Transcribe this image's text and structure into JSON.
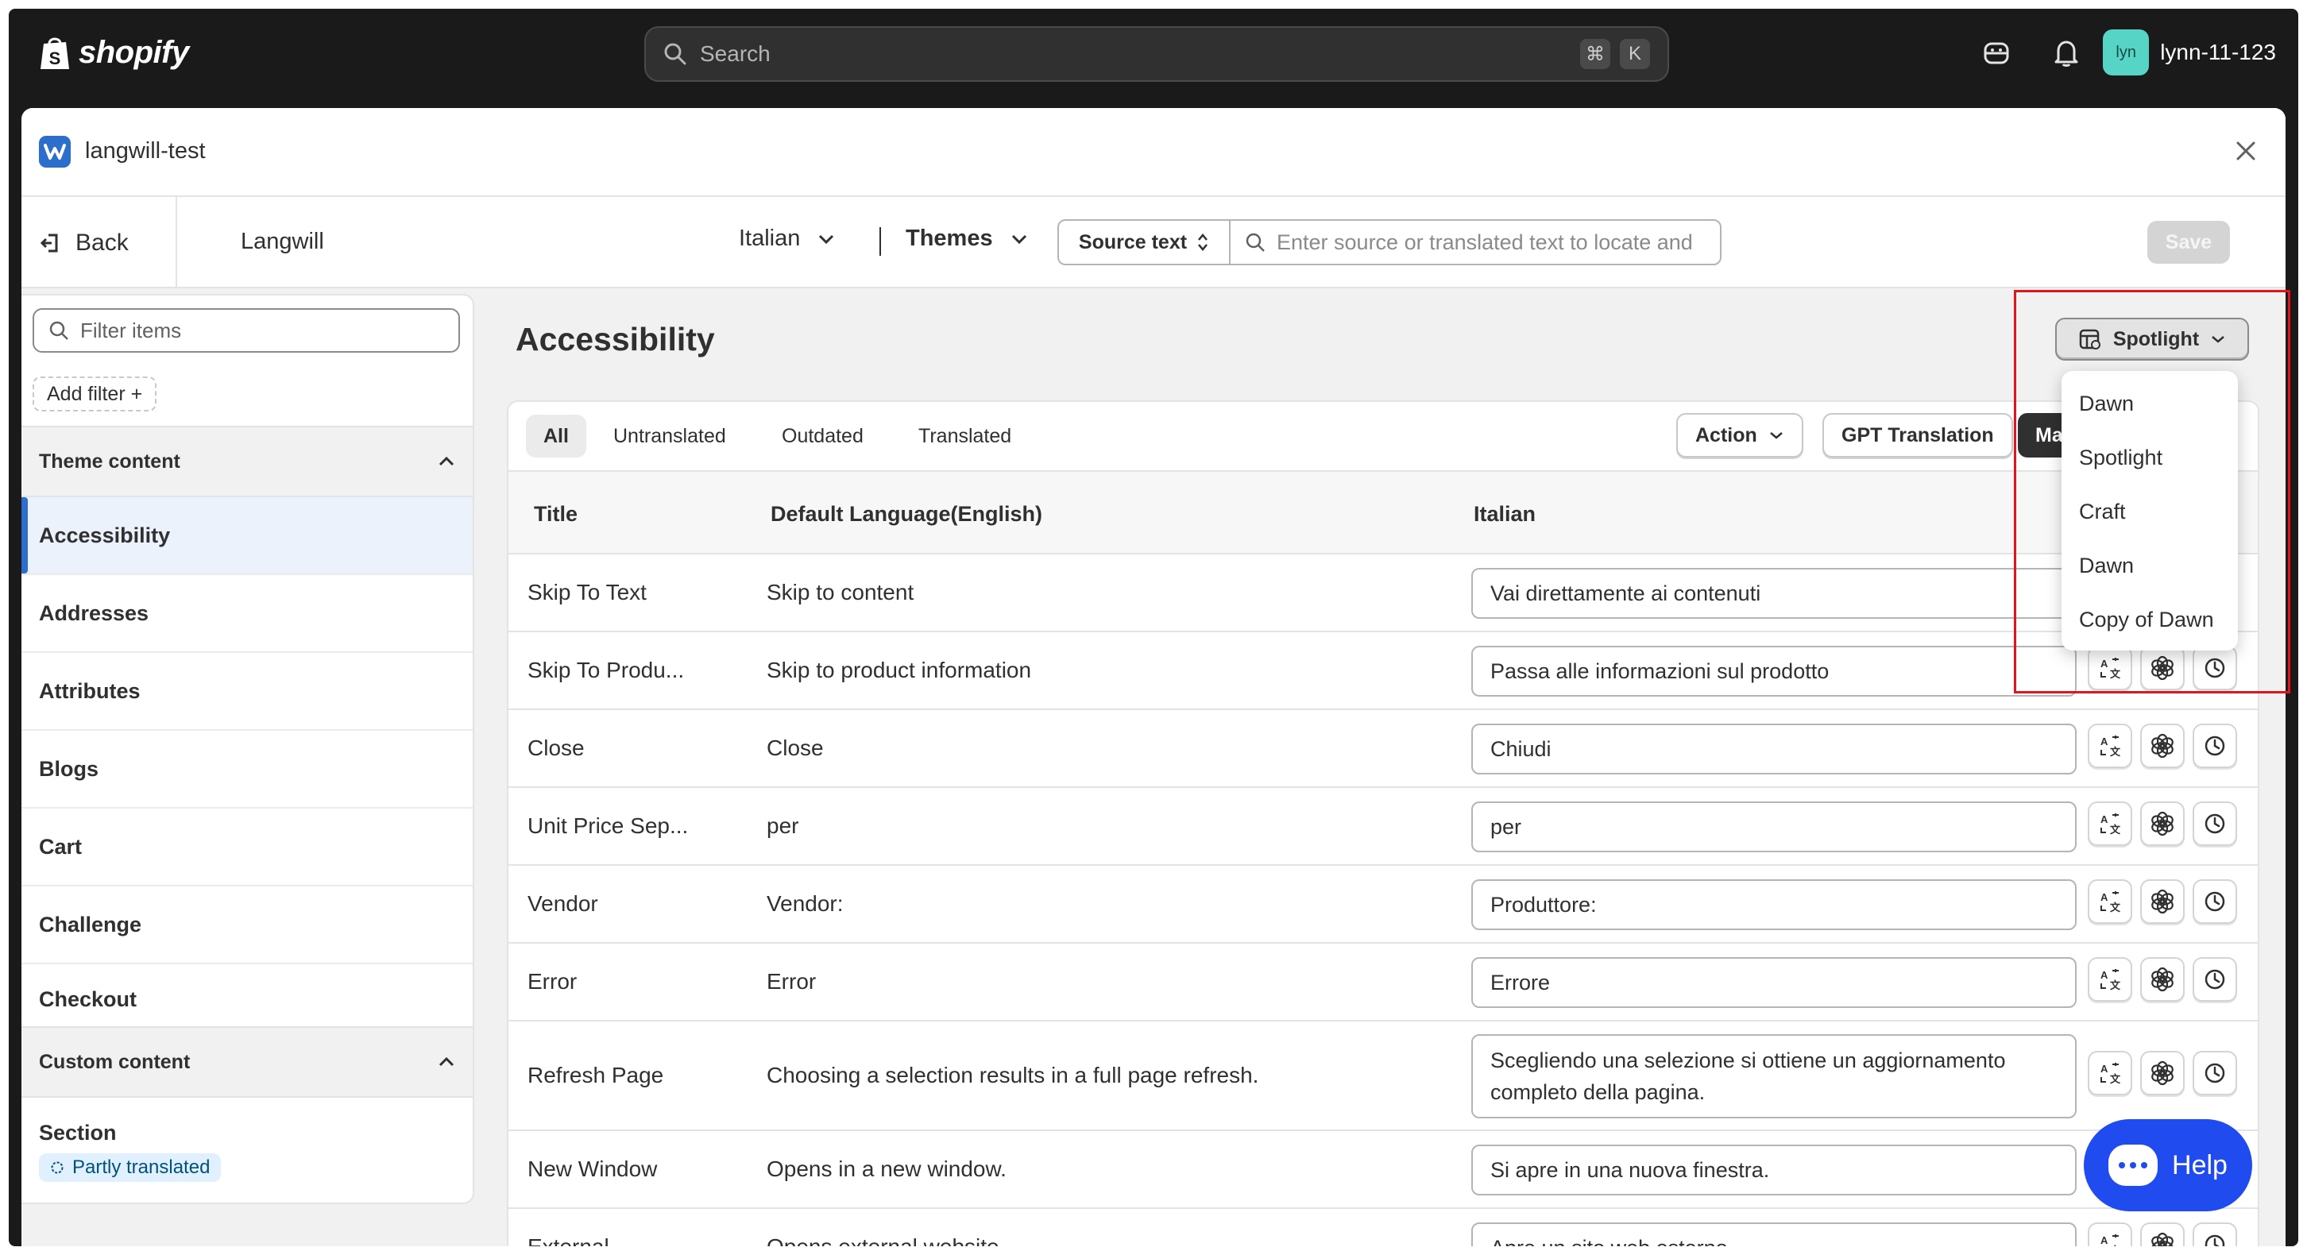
{
  "topbar": {
    "logo_text": "shopify",
    "search_placeholder": "Search",
    "shortcut_1": "⌘",
    "shortcut_2": "K",
    "avatar_initials": "lyn",
    "username": "lynn-11-123"
  },
  "app": {
    "name": "langwill-test",
    "back_label": "Back",
    "app_title": "Langwill",
    "language": "Italian",
    "resource": "Themes",
    "source_select": "Source text",
    "source_placeholder": "Enter source or translated text to locate and",
    "save_label": "Save"
  },
  "sidebar": {
    "filter_placeholder": "Filter items",
    "add_filter": "Add filter +",
    "group1": "Theme content",
    "items": [
      "Accessibility",
      "Addresses",
      "Attributes",
      "Blogs",
      "Cart",
      "Challenge",
      "Checkout"
    ],
    "group2": "Custom content",
    "section_label": "Section",
    "section_badge": "Partly translated"
  },
  "main": {
    "title": "Accessibility",
    "theme_button": "Spotlight",
    "tabs": [
      "All",
      "Untranslated",
      "Outdated",
      "Translated"
    ],
    "action_label": "Action",
    "gpt_label": "GPT Translation",
    "dark_button": "Ma",
    "headers": {
      "title": "Title",
      "default": "Default Language(English)",
      "target": "Italian"
    },
    "rows": [
      {
        "title": "Skip To Text",
        "default": "Skip to content",
        "translation": "Vai direttamente ai contenuti"
      },
      {
        "title": "Skip To Produ...",
        "default": "Skip to product information",
        "translation": "Passa alle informazioni sul prodotto"
      },
      {
        "title": "Close",
        "default": "Close",
        "translation": "Chiudi"
      },
      {
        "title": "Unit Price Sep...",
        "default": "per",
        "translation": "per"
      },
      {
        "title": "Vendor",
        "default": "Vendor:",
        "translation": "Produttore:"
      },
      {
        "title": "Error",
        "default": "Error",
        "translation": "Errore"
      },
      {
        "title": "Refresh Page",
        "default": "Choosing a selection results in a full page refresh.",
        "translation": "Scegliendo una selezione si ottiene un aggiornamento completo della pagina."
      },
      {
        "title": "New Window",
        "default": "Opens in a new window.",
        "translation": "Si apre in una nuova finestra."
      },
      {
        "title": "External",
        "default": "Opens external website.",
        "translation": "Apre un sito web esterno."
      }
    ]
  },
  "theme_dropdown": {
    "options": [
      "Dawn",
      "Spotlight",
      "Craft",
      "Dawn",
      "Copy of Dawn"
    ]
  },
  "help_label": "Help",
  "colors": {
    "accent": "#2c6ecb",
    "help": "#1f4bef",
    "highlight": "#e2141c",
    "topbar": "#1a1a1a"
  }
}
